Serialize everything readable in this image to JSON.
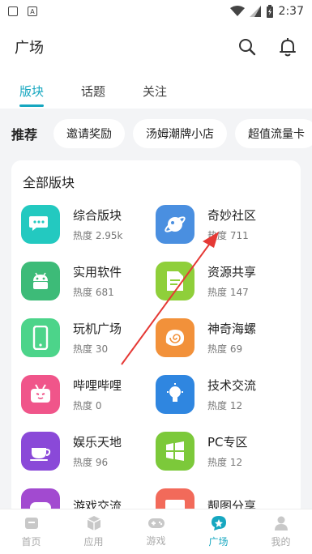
{
  "status": {
    "time": "2:37"
  },
  "header": {
    "title": "广场"
  },
  "tabs": [
    {
      "label": "版块",
      "active": true
    },
    {
      "label": "话题"
    },
    {
      "label": "关注"
    }
  ],
  "recommend": {
    "label": "推荐",
    "chips": [
      "邀请奖励",
      "汤姆潮牌小店",
      "超值流量卡"
    ]
  },
  "boards": {
    "title": "全部版块",
    "items": [
      {
        "name": "综合版块",
        "heat": "热度 2.95k",
        "icon": "chat-bubbles-icon",
        "color": "#23c9c0"
      },
      {
        "name": "奇妙社区",
        "heat": "热度 711",
        "icon": "planet-icon",
        "color": "#4a8fe0"
      },
      {
        "name": "实用软件",
        "heat": "热度 681",
        "icon": "android-icon",
        "color": "#3dbb78"
      },
      {
        "name": "资源共享",
        "heat": "热度 147",
        "icon": "document-icon",
        "color": "#8fcf3a"
      },
      {
        "name": "玩机广场",
        "heat": "热度 30",
        "icon": "phone-icon",
        "color": "#4cd48a"
      },
      {
        "name": "神奇海螺",
        "heat": "热度 69",
        "icon": "shell-icon",
        "color": "#f2913a"
      },
      {
        "name": "哔哩哔哩",
        "heat": "热度 0",
        "icon": "bilibili-icon",
        "color": "#f0558a"
      },
      {
        "name": "技术交流",
        "heat": "热度 12",
        "icon": "lightbulb-icon",
        "color": "#2f86e0"
      },
      {
        "name": "娱乐天地",
        "heat": "热度 96",
        "icon": "coffee-cup-icon",
        "color": "#8a49d8"
      },
      {
        "name": "PC专区",
        "heat": "热度 12",
        "icon": "windows-icon",
        "color": "#7cc93a"
      },
      {
        "name": "游戏交流",
        "heat": "",
        "icon": "gamepad-icon",
        "color": "#a24ad0"
      },
      {
        "name": "靓图分享",
        "heat": "",
        "icon": "image-icon",
        "color": "#f26a5a"
      }
    ]
  },
  "bottom_nav": [
    {
      "label": "首页",
      "icon": "home-icon"
    },
    {
      "label": "应用",
      "icon": "cube-icon"
    },
    {
      "label": "游戏",
      "icon": "gamepad-icon"
    },
    {
      "label": "广场",
      "icon": "plaza-icon",
      "active": true
    },
    {
      "label": "我的",
      "icon": "person-icon"
    }
  ],
  "colors": {
    "accent": "#16a7c0",
    "annotation": "#e53935"
  }
}
